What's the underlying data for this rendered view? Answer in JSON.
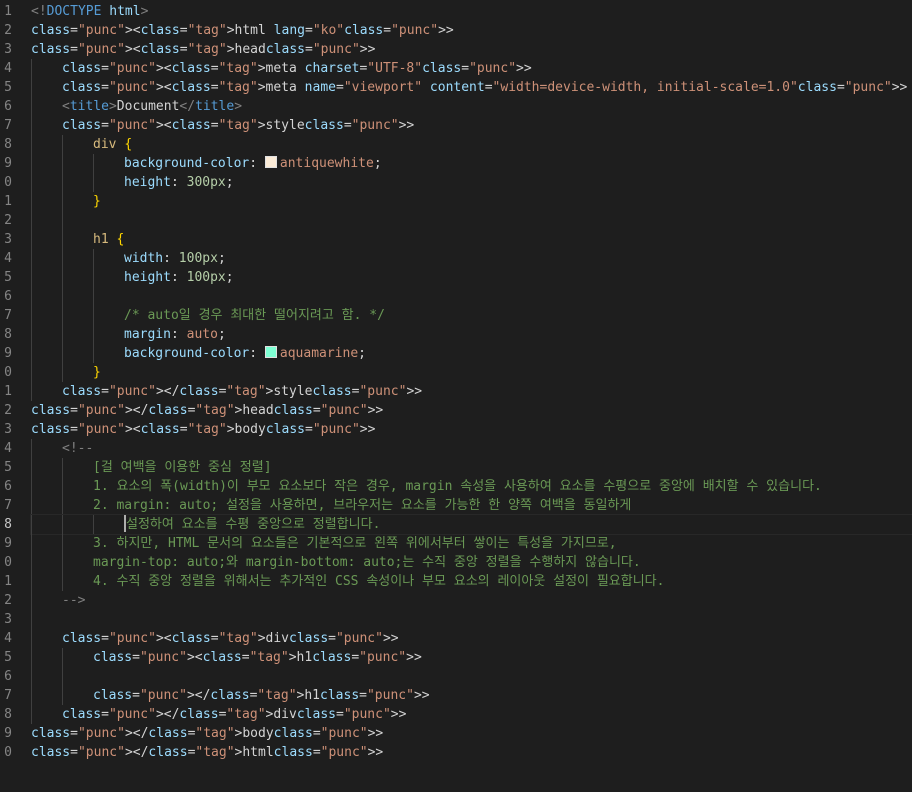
{
  "colors": {
    "antiquewhite": "#faebd7",
    "aquamarine": "#7fffd4"
  },
  "lines": [
    {
      "n": "1",
      "t": "<!DOCTYPE html>"
    },
    {
      "n": "2",
      "t": "<html lang=\"ko\">"
    },
    {
      "n": "3",
      "t": "<head>"
    },
    {
      "n": "4",
      "t": "<meta charset=\"UTF-8\">"
    },
    {
      "n": "5",
      "t": "<meta name=\"viewport\" content=\"width=device-width, initial-scale=1.0\">"
    },
    {
      "n": "6",
      "t": "<title>Document</title>"
    },
    {
      "n": "7",
      "t": "<style>"
    },
    {
      "n": "8",
      "t": "div {"
    },
    {
      "n": "9",
      "t": "background-color: antiquewhite;"
    },
    {
      "n": "0",
      "t": "height: 300px;"
    },
    {
      "n": "1",
      "t": "}"
    },
    {
      "n": "2",
      "t": ""
    },
    {
      "n": "3",
      "t": "h1 {"
    },
    {
      "n": "4",
      "t": "width: 100px;"
    },
    {
      "n": "5",
      "t": "height: 100px;"
    },
    {
      "n": "6",
      "t": ""
    },
    {
      "n": "7",
      "t": "/* auto일 경우 최대한 떨어지려고 함. */"
    },
    {
      "n": "8",
      "t": "margin: auto;"
    },
    {
      "n": "9",
      "t": "background-color: aquamarine;"
    },
    {
      "n": "0",
      "t": "}"
    },
    {
      "n": "1",
      "t": "</style>"
    },
    {
      "n": "2",
      "t": "</head>"
    },
    {
      "n": "3",
      "t": "<body>"
    },
    {
      "n": "4",
      "t": "<!--"
    },
    {
      "n": "5",
      "t": "[걸 여백을 이용한 중심 정렬]"
    },
    {
      "n": "6",
      "t": "1. 요소의 폭(width)이 부모 요소보다 작은 경우, margin 속성을 사용하여 요소를 수평으로 중앙에 배치할 수 있습니다."
    },
    {
      "n": "7",
      "t": "2. margin: auto; 설정을 사용하면, 브라우저는 요소를 가능한 한 양쪽 여백을 동일하게"
    },
    {
      "n": "8",
      "t": "설정하여 요소를 수평 중앙으로 정렬합니다."
    },
    {
      "n": "9",
      "t": "3. 하지만, HTML 문서의 요소들은 기본적으로 왼쪽 위에서부터 쌓이는 특성을 가지므로,"
    },
    {
      "n": "0",
      "t": "margin-top: auto;와 margin-bottom: auto;는 수직 중앙 정렬을 수행하지 않습니다."
    },
    {
      "n": "1",
      "t": "4. 수직 중앙 정렬을 위해서는 추가적인 CSS 속성이나 부모 요소의 레이아웃 설정이 필요합니다."
    },
    {
      "n": "2",
      "t": "-->"
    },
    {
      "n": "3",
      "t": ""
    },
    {
      "n": "4",
      "t": "<div>"
    },
    {
      "n": "5",
      "t": "<h1>"
    },
    {
      "n": "6",
      "t": ""
    },
    {
      "n": "7",
      "t": "</h1>"
    },
    {
      "n": "8",
      "t": "</div>"
    },
    {
      "n": "9",
      "t": "</body>"
    },
    {
      "n": "0",
      "t": "</html>"
    }
  ]
}
